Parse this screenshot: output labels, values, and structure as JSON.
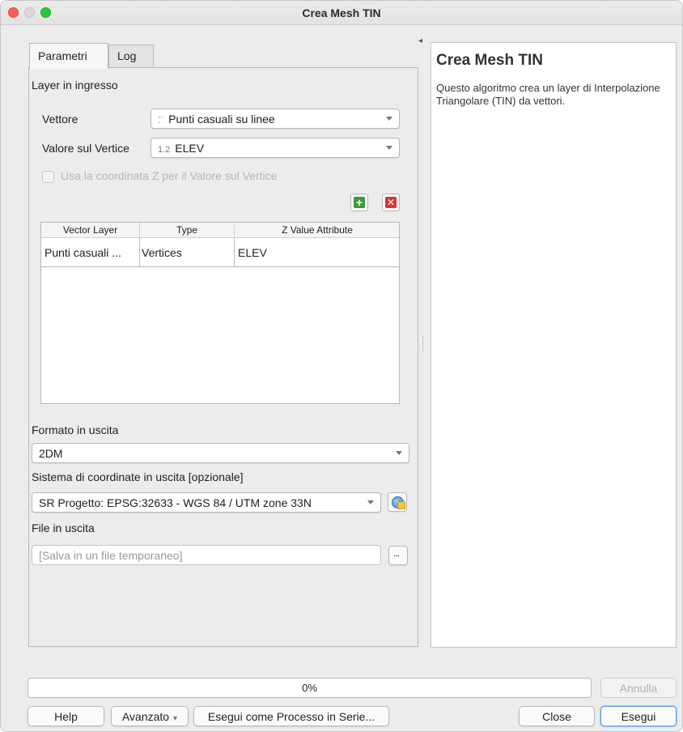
{
  "window": {
    "title": "Crea Mesh TIN"
  },
  "tabs": [
    {
      "label": "Parametri",
      "active": true
    },
    {
      "label": "Log",
      "active": false
    }
  ],
  "input_section": {
    "title": "Layer in ingresso",
    "vector_label": "Vettore",
    "vector_value": "Punti casuali su linee",
    "vertex_value_label": "Valore sul Vertice",
    "vertex_value_prefix": "1.2",
    "vertex_value": "ELEV",
    "use_z_label": "Usa la coordinata Z per il Valore sul Vertice",
    "use_z_checked": false
  },
  "layer_table": {
    "columns": [
      "Vector Layer",
      "Type",
      "Z Value Attribute"
    ],
    "rows": [
      [
        "Punti casuali ...",
        "Vertices",
        "ELEV"
      ]
    ]
  },
  "output_format": {
    "label": "Formato in uscita",
    "value": "2DM"
  },
  "output_crs": {
    "label": "Sistema di coordinate in uscita [opzionale]",
    "value": "SR Progetto: EPSG:32633 - WGS 84 / UTM zone 33N"
  },
  "output_file": {
    "label": "File in uscita",
    "placeholder": "[Salva in un file temporaneo]",
    "browse_label": "..."
  },
  "help": {
    "title": "Crea Mesh TIN",
    "text": "Questo algoritmo crea un layer di Interpolazione Triangolare (TIN) da vettori."
  },
  "progress": {
    "value": 0,
    "text": "0%"
  },
  "buttons": {
    "cancel": "Annulla",
    "help": "Help",
    "advanced": "Avanzato",
    "batch": "Esegui come Processo in Serie...",
    "close": "Close",
    "run": "Esegui"
  },
  "colors": {
    "accent": "#3b86ff",
    "add_green": "#3a9b3a",
    "remove_red": "#d9362f",
    "close_red": "#ff5f57",
    "zoom_green": "#28c840"
  }
}
